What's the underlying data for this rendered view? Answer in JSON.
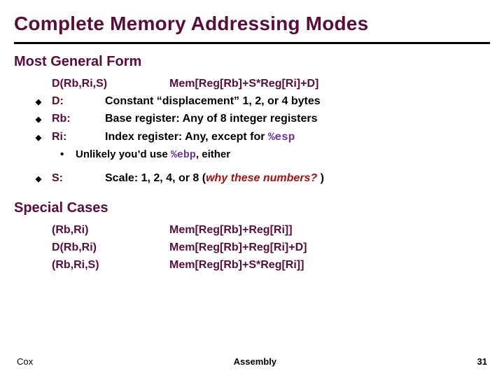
{
  "title": "Complete Memory Addressing Modes",
  "section1": "Most General Form",
  "general": {
    "syntax": "D(Rb,Ri,S)",
    "meaning": "Mem[Reg[Rb]+S*Reg[Ri]+D]",
    "items": [
      {
        "label": "D:",
        "desc": "Constant “displacement” 1, 2, or 4 bytes"
      },
      {
        "label": "Rb:",
        "desc": "Base register: Any of 8 integer registers"
      },
      {
        "label": "Ri:",
        "desc_prefix": "Index register: Any, except for ",
        "desc_mono": "%esp"
      }
    ],
    "note_prefix": "Unlikely you’d use ",
    "note_mono": "%ebp",
    "note_suffix": ", either",
    "scale": {
      "label": "S:",
      "desc_prefix": "Scale: 1, 2, 4, or 8 (",
      "desc_emph": "why these numbers?",
      "desc_suffix": " )"
    }
  },
  "section2": "Special Cases",
  "special": [
    {
      "syntax": "(Rb,Ri)",
      "meaning": "Mem[Reg[Rb]+Reg[Ri]]"
    },
    {
      "syntax": "D(Rb,Ri)",
      "meaning": "Mem[Reg[Rb]+Reg[Ri]+D]"
    },
    {
      "syntax": "(Rb,Ri,S)",
      "meaning": "Mem[Reg[Rb]+S*Reg[Ri]]"
    }
  ],
  "footer": {
    "left": "Cox",
    "mid": "Assembly",
    "right": "31"
  }
}
